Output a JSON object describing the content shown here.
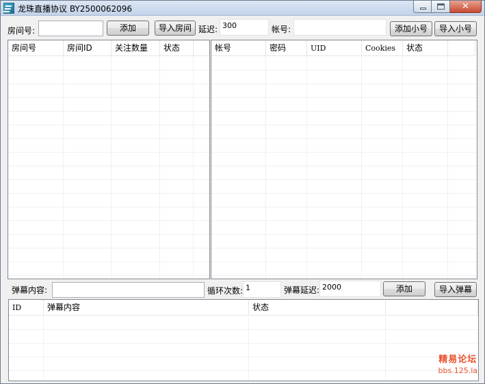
{
  "window": {
    "title": "龙珠直播协议 BY2500062096",
    "icon": "app-icon",
    "controls": {
      "minimize": "minimize-icon",
      "maximize": "maximize-icon",
      "close_glyph": "✕"
    }
  },
  "room_bar": {
    "room_label": "房间号:",
    "room_value": "",
    "add_button": "添加",
    "import_button": "导入房间",
    "delay_label": "延迟:",
    "delay_value": "300"
  },
  "account_bar": {
    "account_label": "帐号:",
    "account_value": "",
    "add_button": "添加小号",
    "import_button": "导入小号"
  },
  "room_list": {
    "columns": [
      "房间号",
      "房间ID",
      "关注数量",
      "状态",
      ""
    ],
    "rows": []
  },
  "account_list": {
    "columns": [
      "帐号",
      "密码",
      "UID",
      "Cookies",
      "状态",
      ""
    ],
    "rows": []
  },
  "danmu_bar": {
    "content_label": "弹幕内容:",
    "content_value": "",
    "loop_label": "循环次数:",
    "loop_value": "1",
    "delay_label": "弹幕延迟:",
    "delay_value": "2000",
    "add_button": "添加",
    "import_button": "导入弹幕"
  },
  "danmu_list": {
    "columns": [
      "ID",
      "弹幕内容",
      "状态",
      ""
    ],
    "rows": []
  },
  "watermark": {
    "title": "精易论坛",
    "url": "bbs.125.la"
  }
}
